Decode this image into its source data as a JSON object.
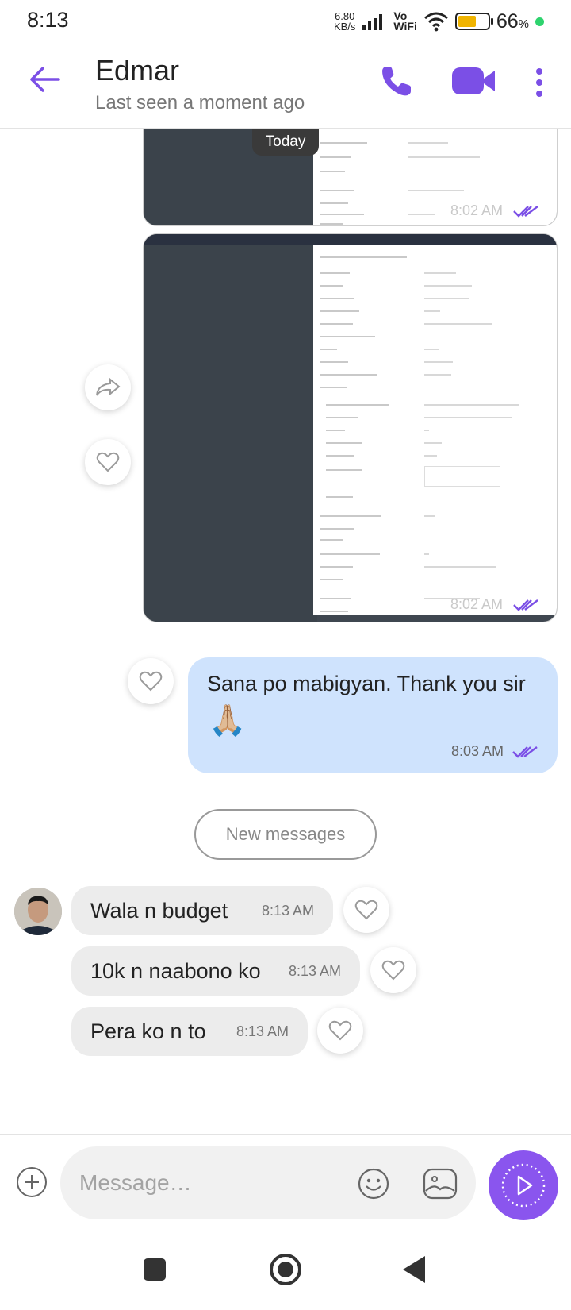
{
  "status_bar": {
    "time": "8:13",
    "net_speed_value": "6.80",
    "net_speed_unit": "KB/s",
    "vowifi_top": "Vo",
    "vowifi_bottom": "WiFi",
    "battery_percent": 66,
    "battery_label": "66",
    "battery_unit": "%"
  },
  "header": {
    "contact_name": "Edmar",
    "last_seen": "Last seen a moment ago",
    "accent_color": "#7b4fe6",
    "icons": [
      "back-arrow-icon",
      "phone-icon",
      "video-camera-icon",
      "more-vertical-icon"
    ]
  },
  "chat": {
    "date_separator": "Today",
    "image_messages": [
      {
        "time": "8:02 AM",
        "status": "read"
      },
      {
        "time": "8:02 AM",
        "status": "read"
      }
    ],
    "outgoing_message": {
      "text": "Sana po mabigyan. Thank you sir",
      "emoji": "🙏🏼",
      "time": "8:03 AM",
      "status": "read",
      "bubble_color": "#cfe3fd"
    },
    "new_messages_label": "New messages",
    "incoming_messages": [
      {
        "text": "Wala n budget",
        "time": "8:13 AM"
      },
      {
        "text": "10k n naabono ko",
        "time": "8:13 AM"
      },
      {
        "text": "Pera ko n to",
        "time": "8:13 AM"
      }
    ]
  },
  "composer": {
    "placeholder": "Message…",
    "value": "",
    "icons": [
      "add-attachment-icon",
      "emoji-icon",
      "gallery-icon",
      "send-voice-icon"
    ],
    "send_color": "#8a55ee"
  }
}
